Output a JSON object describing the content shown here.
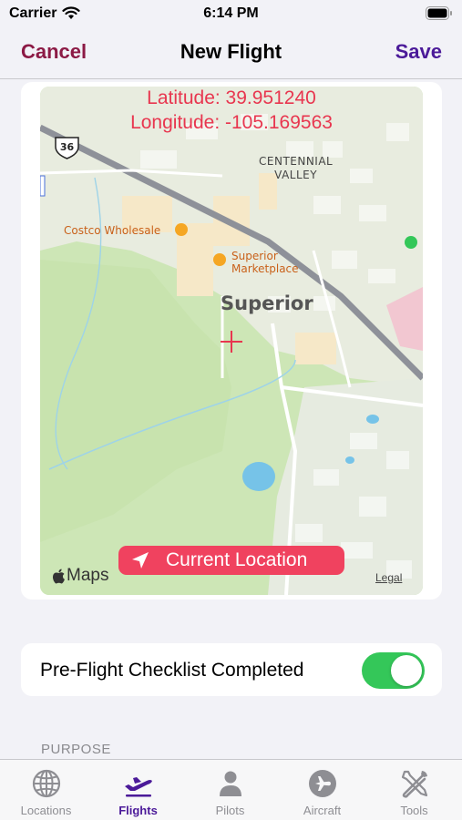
{
  "status_bar": {
    "carrier": "Carrier",
    "time": "6:14 PM"
  },
  "nav": {
    "cancel_label": "Cancel",
    "title": "New Flight",
    "save_label": "Save"
  },
  "map": {
    "latitude_text": "Latitude: 39.951240",
    "longitude_text": "Longitude: -105.169563",
    "current_location_label": "Current Location",
    "maps_brand": "Maps",
    "legal_label": "Legal",
    "route_shield": "36",
    "labels": {
      "centennial_valley": [
        "CENTENNIAL",
        "VALLEY"
      ],
      "costco": "Costco Wholesale",
      "marketplace": [
        "Superior",
        "Marketplace"
      ],
      "town": "Superior"
    }
  },
  "checklist": {
    "label": "Pre-Flight Checklist Completed",
    "enabled": true
  },
  "section_header": "PURPOSE",
  "tabs": [
    {
      "label": "Locations",
      "icon": "globe-icon",
      "active": false
    },
    {
      "label": "Flights",
      "icon": "airplane-icon",
      "active": true
    },
    {
      "label": "Pilots",
      "icon": "person-icon",
      "active": false
    },
    {
      "label": "Aircraft",
      "icon": "aircraft-circle-icon",
      "active": false
    },
    {
      "label": "Tools",
      "icon": "tools-icon",
      "active": false
    }
  ],
  "colors": {
    "accent_purple": "#4b1a99",
    "cancel_red": "#8c1a45",
    "coordinate_red": "#e8364f",
    "location_button": "#f0425f",
    "toggle_green": "#34c759"
  }
}
